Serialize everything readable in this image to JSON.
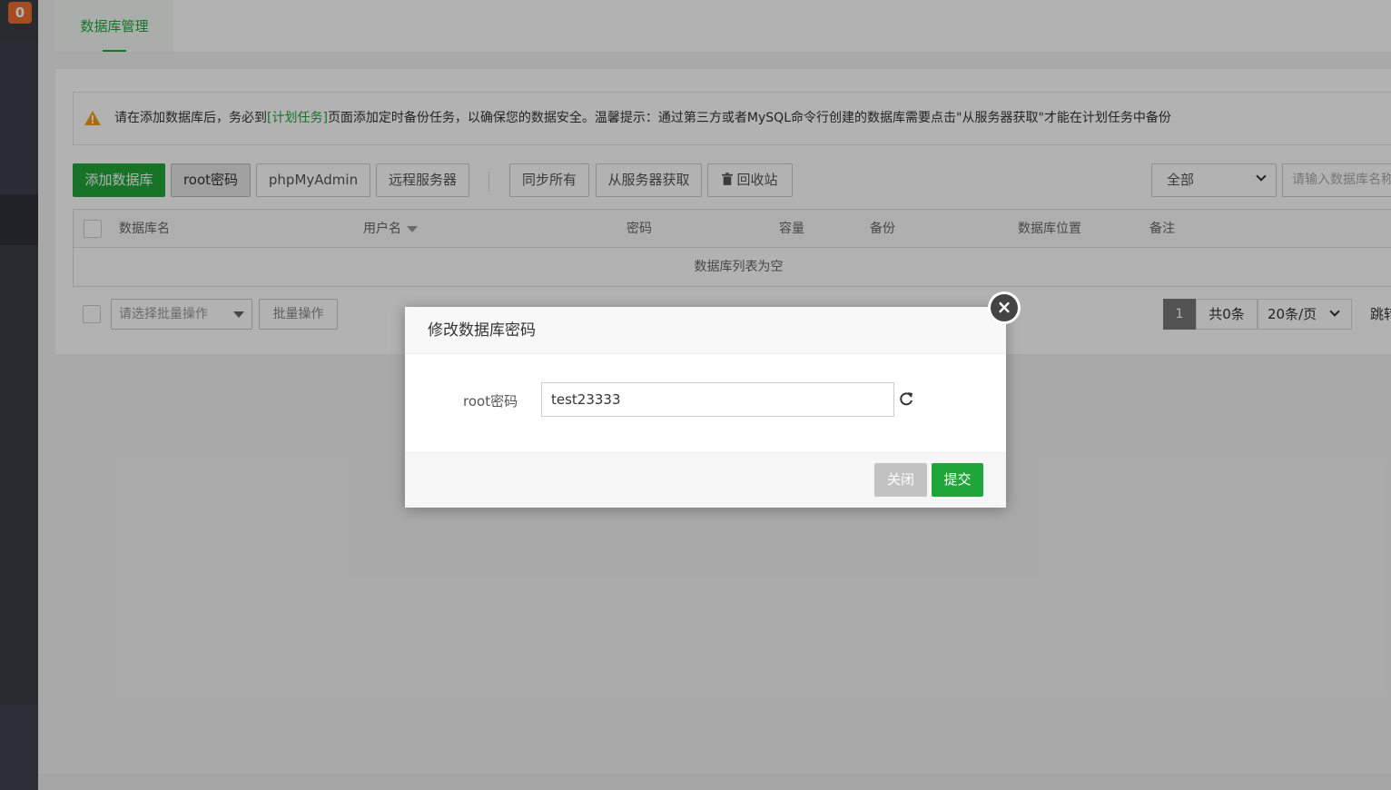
{
  "sidebar": {
    "badge_count": "0"
  },
  "tabs": [
    {
      "label": "数据库管理"
    }
  ],
  "notice": {
    "prefix": "请在添加数据库后，务必到",
    "link": "[计划任务]",
    "suffix": "页面添加定时备份任务，以确保您的数据安全。温馨提示：通过第三方或者MySQL命令行创建的数据库需要点击\"从服务器获取\"才能在计划任务中备份"
  },
  "toolbar": {
    "add_db": "添加数据库",
    "root_password": "root密码",
    "phpmyadmin": "phpMyAdmin",
    "remote_server": "远程服务器",
    "sync_all": "同步所有",
    "fetch_from_server": "从服务器获取",
    "recycle_bin": "回收站",
    "filter_selected": "全部",
    "search_placeholder": "请输入数据库名称"
  },
  "table": {
    "columns": [
      "数据库名",
      "用户名",
      "密码",
      "容量",
      "备份",
      "数据库位置",
      "备注"
    ],
    "empty_text": "数据库列表为空"
  },
  "batch": {
    "select_placeholder": "请选择批量操作",
    "button": "批量操作"
  },
  "pager": {
    "current": "1",
    "total": "共0条",
    "page_size": "20条/页",
    "jump": "跳转"
  },
  "modal": {
    "title": "修改数据库密码",
    "field_label": "root密码",
    "field_value": "test23333",
    "close": "关闭",
    "submit": "提交"
  },
  "colors": {
    "accent": "#20a53a",
    "warning": "#f39c12",
    "badge": "#f06d32"
  }
}
